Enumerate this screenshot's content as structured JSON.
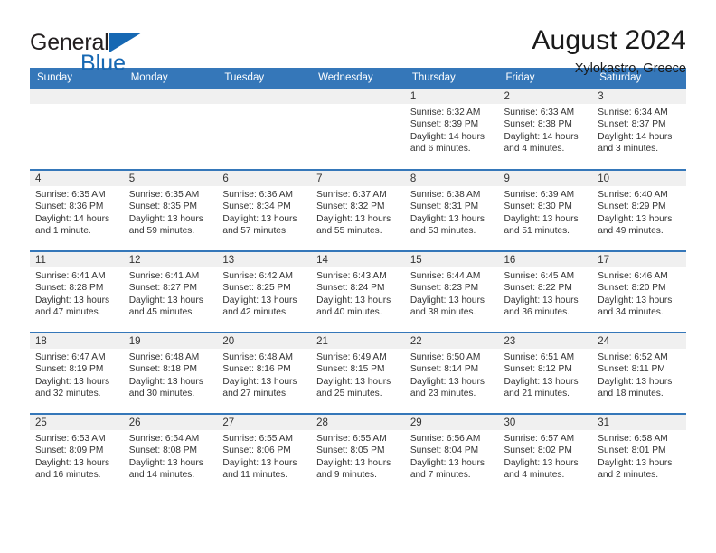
{
  "brand": {
    "name_part1": "General",
    "name_part2": "Blue",
    "triangle_icon": "triangle-icon",
    "color_primary": "#1668b3",
    "color_text": "#231f20"
  },
  "header": {
    "title": "August 2024",
    "subtitle": "Xylokastro, Greece"
  },
  "theme": {
    "header_row_bg": "#3577b9",
    "cell_header_bg": "#f0f0f0",
    "grid_line": "#3577b9"
  },
  "weekdays": [
    "Sunday",
    "Monday",
    "Tuesday",
    "Wednesday",
    "Thursday",
    "Friday",
    "Saturday"
  ],
  "weeks": [
    [
      {
        "day": "",
        "empty": true
      },
      {
        "day": "",
        "empty": true
      },
      {
        "day": "",
        "empty": true
      },
      {
        "day": "",
        "empty": true
      },
      {
        "day": "1",
        "sunrise": "Sunrise: 6:32 AM",
        "sunset": "Sunset: 8:39 PM",
        "daylight_line1": "Daylight: 14 hours",
        "daylight_line2": "and 6 minutes."
      },
      {
        "day": "2",
        "sunrise": "Sunrise: 6:33 AM",
        "sunset": "Sunset: 8:38 PM",
        "daylight_line1": "Daylight: 14 hours",
        "daylight_line2": "and 4 minutes."
      },
      {
        "day": "3",
        "sunrise": "Sunrise: 6:34 AM",
        "sunset": "Sunset: 8:37 PM",
        "daylight_line1": "Daylight: 14 hours",
        "daylight_line2": "and 3 minutes."
      }
    ],
    [
      {
        "day": "4",
        "sunrise": "Sunrise: 6:35 AM",
        "sunset": "Sunset: 8:36 PM",
        "daylight_line1": "Daylight: 14 hours",
        "daylight_line2": "and 1 minute."
      },
      {
        "day": "5",
        "sunrise": "Sunrise: 6:35 AM",
        "sunset": "Sunset: 8:35 PM",
        "daylight_line1": "Daylight: 13 hours",
        "daylight_line2": "and 59 minutes."
      },
      {
        "day": "6",
        "sunrise": "Sunrise: 6:36 AM",
        "sunset": "Sunset: 8:34 PM",
        "daylight_line1": "Daylight: 13 hours",
        "daylight_line2": "and 57 minutes."
      },
      {
        "day": "7",
        "sunrise": "Sunrise: 6:37 AM",
        "sunset": "Sunset: 8:32 PM",
        "daylight_line1": "Daylight: 13 hours",
        "daylight_line2": "and 55 minutes."
      },
      {
        "day": "8",
        "sunrise": "Sunrise: 6:38 AM",
        "sunset": "Sunset: 8:31 PM",
        "daylight_line1": "Daylight: 13 hours",
        "daylight_line2": "and 53 minutes."
      },
      {
        "day": "9",
        "sunrise": "Sunrise: 6:39 AM",
        "sunset": "Sunset: 8:30 PM",
        "daylight_line1": "Daylight: 13 hours",
        "daylight_line2": "and 51 minutes."
      },
      {
        "day": "10",
        "sunrise": "Sunrise: 6:40 AM",
        "sunset": "Sunset: 8:29 PM",
        "daylight_line1": "Daylight: 13 hours",
        "daylight_line2": "and 49 minutes."
      }
    ],
    [
      {
        "day": "11",
        "sunrise": "Sunrise: 6:41 AM",
        "sunset": "Sunset: 8:28 PM",
        "daylight_line1": "Daylight: 13 hours",
        "daylight_line2": "and 47 minutes."
      },
      {
        "day": "12",
        "sunrise": "Sunrise: 6:41 AM",
        "sunset": "Sunset: 8:27 PM",
        "daylight_line1": "Daylight: 13 hours",
        "daylight_line2": "and 45 minutes."
      },
      {
        "day": "13",
        "sunrise": "Sunrise: 6:42 AM",
        "sunset": "Sunset: 8:25 PM",
        "daylight_line1": "Daylight: 13 hours",
        "daylight_line2": "and 42 minutes."
      },
      {
        "day": "14",
        "sunrise": "Sunrise: 6:43 AM",
        "sunset": "Sunset: 8:24 PM",
        "daylight_line1": "Daylight: 13 hours",
        "daylight_line2": "and 40 minutes."
      },
      {
        "day": "15",
        "sunrise": "Sunrise: 6:44 AM",
        "sunset": "Sunset: 8:23 PM",
        "daylight_line1": "Daylight: 13 hours",
        "daylight_line2": "and 38 minutes."
      },
      {
        "day": "16",
        "sunrise": "Sunrise: 6:45 AM",
        "sunset": "Sunset: 8:22 PM",
        "daylight_line1": "Daylight: 13 hours",
        "daylight_line2": "and 36 minutes."
      },
      {
        "day": "17",
        "sunrise": "Sunrise: 6:46 AM",
        "sunset": "Sunset: 8:20 PM",
        "daylight_line1": "Daylight: 13 hours",
        "daylight_line2": "and 34 minutes."
      }
    ],
    [
      {
        "day": "18",
        "sunrise": "Sunrise: 6:47 AM",
        "sunset": "Sunset: 8:19 PM",
        "daylight_line1": "Daylight: 13 hours",
        "daylight_line2": "and 32 minutes."
      },
      {
        "day": "19",
        "sunrise": "Sunrise: 6:48 AM",
        "sunset": "Sunset: 8:18 PM",
        "daylight_line1": "Daylight: 13 hours",
        "daylight_line2": "and 30 minutes."
      },
      {
        "day": "20",
        "sunrise": "Sunrise: 6:48 AM",
        "sunset": "Sunset: 8:16 PM",
        "daylight_line1": "Daylight: 13 hours",
        "daylight_line2": "and 27 minutes."
      },
      {
        "day": "21",
        "sunrise": "Sunrise: 6:49 AM",
        "sunset": "Sunset: 8:15 PM",
        "daylight_line1": "Daylight: 13 hours",
        "daylight_line2": "and 25 minutes."
      },
      {
        "day": "22",
        "sunrise": "Sunrise: 6:50 AM",
        "sunset": "Sunset: 8:14 PM",
        "daylight_line1": "Daylight: 13 hours",
        "daylight_line2": "and 23 minutes."
      },
      {
        "day": "23",
        "sunrise": "Sunrise: 6:51 AM",
        "sunset": "Sunset: 8:12 PM",
        "daylight_line1": "Daylight: 13 hours",
        "daylight_line2": "and 21 minutes."
      },
      {
        "day": "24",
        "sunrise": "Sunrise: 6:52 AM",
        "sunset": "Sunset: 8:11 PM",
        "daylight_line1": "Daylight: 13 hours",
        "daylight_line2": "and 18 minutes."
      }
    ],
    [
      {
        "day": "25",
        "sunrise": "Sunrise: 6:53 AM",
        "sunset": "Sunset: 8:09 PM",
        "daylight_line1": "Daylight: 13 hours",
        "daylight_line2": "and 16 minutes."
      },
      {
        "day": "26",
        "sunrise": "Sunrise: 6:54 AM",
        "sunset": "Sunset: 8:08 PM",
        "daylight_line1": "Daylight: 13 hours",
        "daylight_line2": "and 14 minutes."
      },
      {
        "day": "27",
        "sunrise": "Sunrise: 6:55 AM",
        "sunset": "Sunset: 8:06 PM",
        "daylight_line1": "Daylight: 13 hours",
        "daylight_line2": "and 11 minutes."
      },
      {
        "day": "28",
        "sunrise": "Sunrise: 6:55 AM",
        "sunset": "Sunset: 8:05 PM",
        "daylight_line1": "Daylight: 13 hours",
        "daylight_line2": "and 9 minutes."
      },
      {
        "day": "29",
        "sunrise": "Sunrise: 6:56 AM",
        "sunset": "Sunset: 8:04 PM",
        "daylight_line1": "Daylight: 13 hours",
        "daylight_line2": "and 7 minutes."
      },
      {
        "day": "30",
        "sunrise": "Sunrise: 6:57 AM",
        "sunset": "Sunset: 8:02 PM",
        "daylight_line1": "Daylight: 13 hours",
        "daylight_line2": "and 4 minutes."
      },
      {
        "day": "31",
        "sunrise": "Sunrise: 6:58 AM",
        "sunset": "Sunset: 8:01 PM",
        "daylight_line1": "Daylight: 13 hours",
        "daylight_line2": "and 2 minutes."
      }
    ]
  ]
}
